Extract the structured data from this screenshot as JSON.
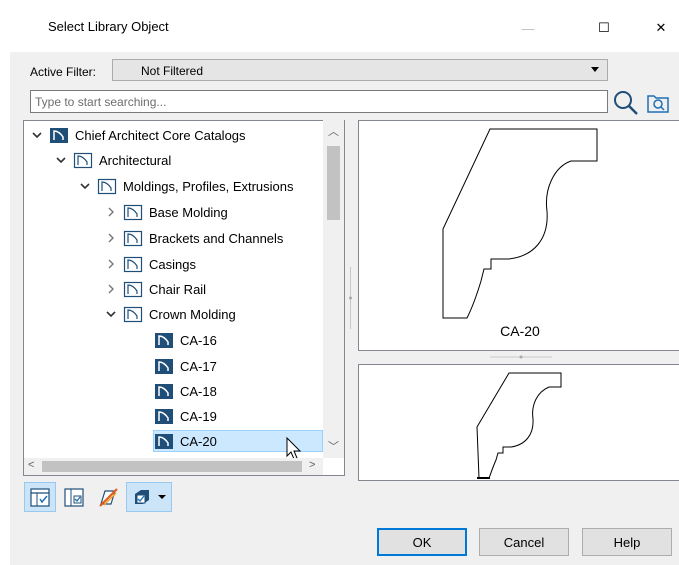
{
  "window": {
    "title": "Select Library Object",
    "minimize_glyph": "—",
    "maximize_glyph": "☐",
    "close_glyph": "✕"
  },
  "filter": {
    "label": "Active Filter:",
    "value": "Not Filtered"
  },
  "search": {
    "placeholder": "Type to start searching..."
  },
  "tree": {
    "items": [
      {
        "label": "Chief Architect Core Catalogs",
        "icon": "catalog-icon",
        "expanded": true
      },
      {
        "label": "Architectural",
        "icon": "folder-icon",
        "expanded": true
      },
      {
        "label": "Moldings, Profiles, Extrusions",
        "icon": "folder-icon",
        "expanded": true
      },
      {
        "label": "Base Molding",
        "icon": "folder-icon",
        "expanded": false
      },
      {
        "label": "Brackets and Channels",
        "icon": "folder-icon",
        "expanded": false
      },
      {
        "label": "Casings",
        "icon": "folder-icon",
        "expanded": false
      },
      {
        "label": "Chair Rail",
        "icon": "folder-icon",
        "expanded": false
      },
      {
        "label": "Crown Molding",
        "icon": "folder-icon",
        "expanded": true
      },
      {
        "label": "CA-16",
        "icon": "profile-icon"
      },
      {
        "label": "CA-17",
        "icon": "profile-icon"
      },
      {
        "label": "CA-18",
        "icon": "profile-icon"
      },
      {
        "label": "CA-19",
        "icon": "profile-icon"
      },
      {
        "label": "CA-20",
        "icon": "profile-icon",
        "selected": true
      }
    ]
  },
  "preview": {
    "label": "CA-20"
  },
  "toolbar": {
    "icons": [
      "show-folders-icon",
      "show-selected-icon",
      "show-materials-icon",
      "view-mode-icon"
    ]
  },
  "buttons": {
    "ok": "OK",
    "cancel": "Cancel",
    "help": "Help"
  },
  "colors": {
    "selection": "#cce8ff",
    "accent": "#0078d7",
    "catalog_icon": "#1f4e79"
  }
}
